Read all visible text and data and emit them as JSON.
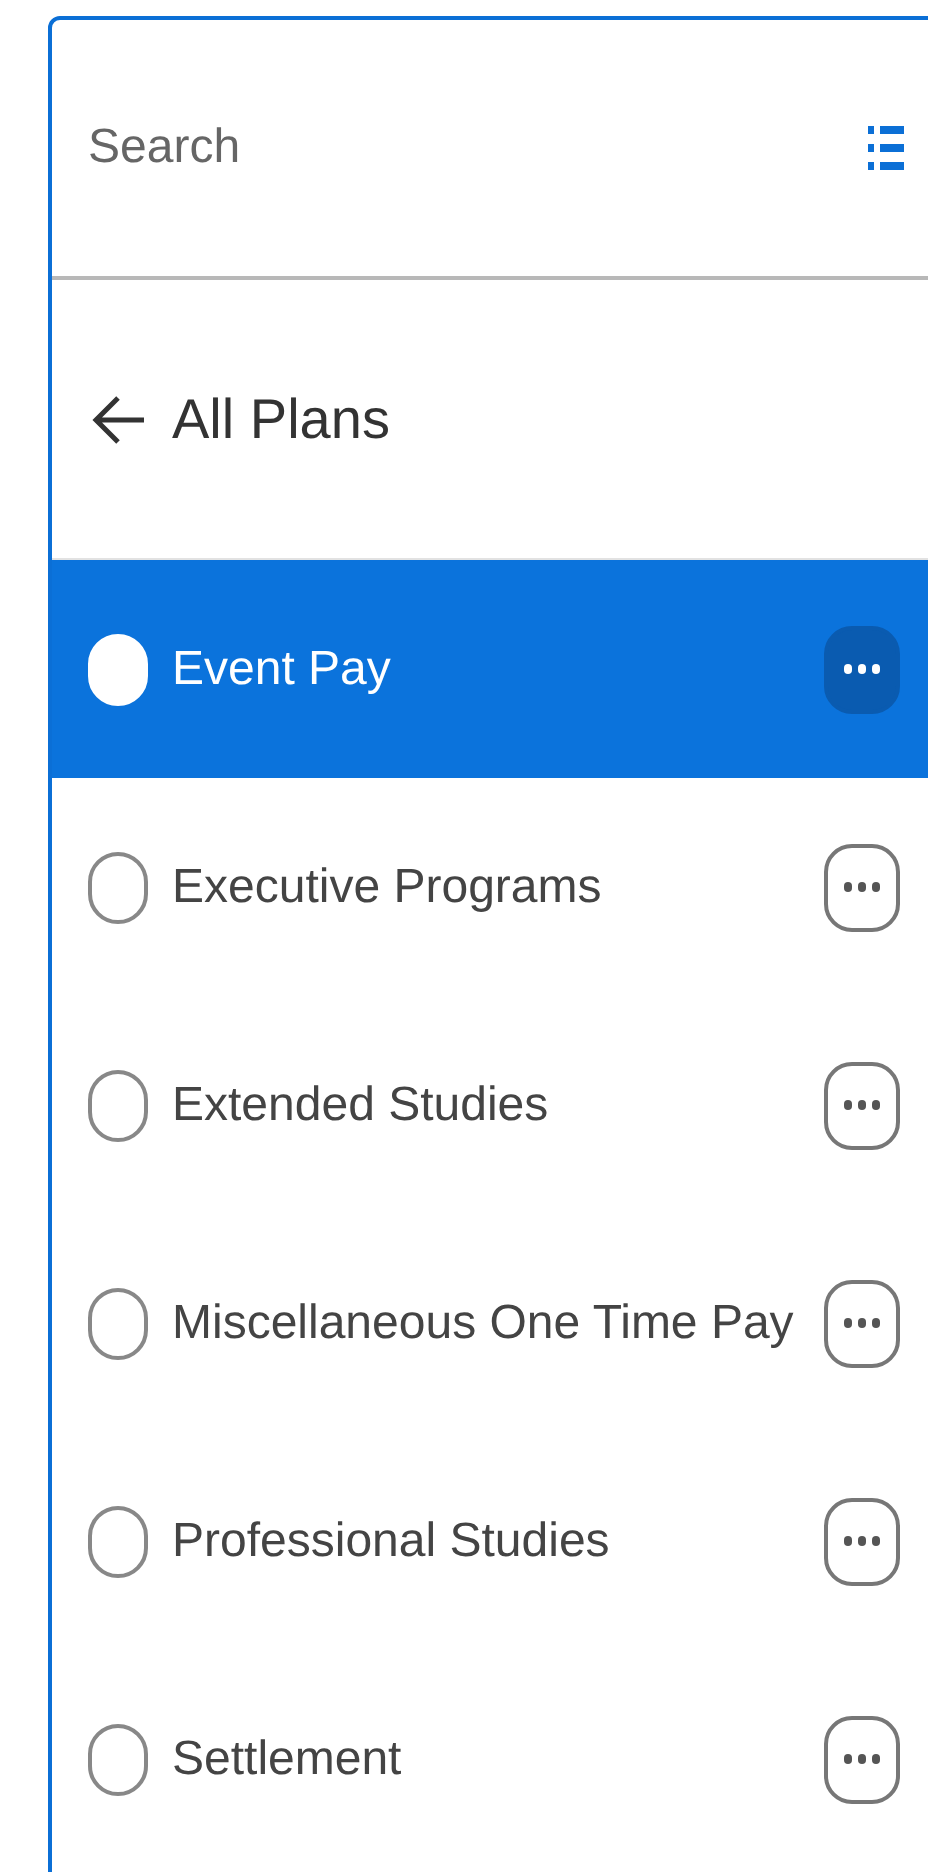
{
  "search": {
    "placeholder": "Search"
  },
  "header": {
    "title": "All Plans"
  },
  "plans": [
    {
      "label": "Event Pay",
      "selected": true
    },
    {
      "label": "Executive Programs",
      "selected": false
    },
    {
      "label": "Extended Studies",
      "selected": false
    },
    {
      "label": "Miscellaneous One Time Pay",
      "selected": false
    },
    {
      "label": "Professional Studies",
      "selected": false
    },
    {
      "label": "Settlement",
      "selected": false
    }
  ]
}
